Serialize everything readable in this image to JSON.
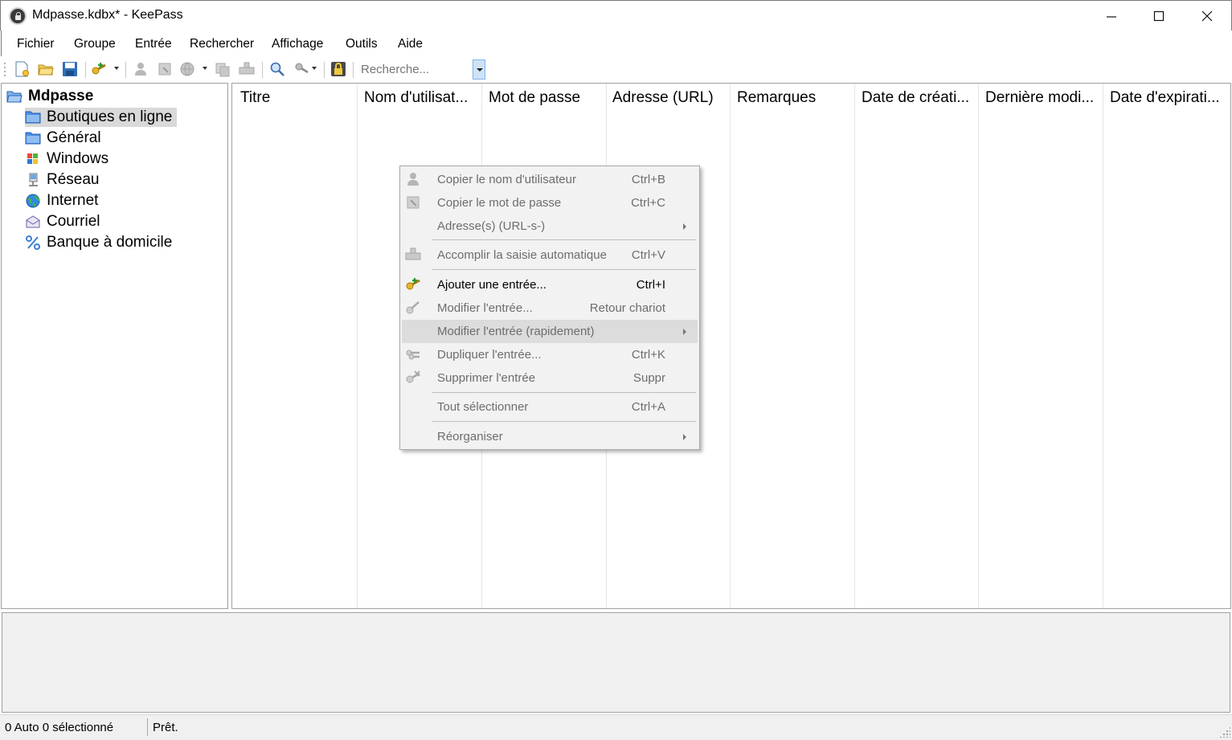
{
  "window": {
    "title": "Mdpasse.kdbx* - KeePass",
    "minimize_glyph": "—",
    "maximize_glyph": "☐",
    "close_glyph": "✕"
  },
  "menubar": {
    "items": [
      "Fichier",
      "Groupe",
      "Entrée",
      "Rechercher",
      "Affichage",
      "Outils",
      "Aide"
    ]
  },
  "toolbar": {
    "search_placeholder": "Recherche...",
    "icons": [
      "new-database-icon",
      "open-database-icon",
      "save-icon",
      "add-entry-icon",
      "copy-username-icon",
      "copy-password-icon",
      "open-url-icon",
      "copy-url-icon",
      "autotype-icon",
      "find-icon",
      "entry-list-icon",
      "lock-workspace-icon"
    ]
  },
  "tree": {
    "root": "Mdpasse",
    "groups": [
      {
        "label": "Boutiques en ligne",
        "icon": "folder-icon",
        "selected": true
      },
      {
        "label": "Général",
        "icon": "folder-icon",
        "selected": false
      },
      {
        "label": "Windows",
        "icon": "windows-icon",
        "selected": false
      },
      {
        "label": "Réseau",
        "icon": "network-icon",
        "selected": false
      },
      {
        "label": "Internet",
        "icon": "globe-icon",
        "selected": false
      },
      {
        "label": "Courriel",
        "icon": "envelope-icon",
        "selected": false
      },
      {
        "label": "Banque à domicile",
        "icon": "percent-icon",
        "selected": false
      }
    ]
  },
  "list": {
    "columns": [
      "Titre",
      "Nom d'utilisat...",
      "Mot de passe",
      "Adresse (URL)",
      "Remarques",
      "Date de créati...",
      "Dernière modi...",
      "Date d'expirati..."
    ]
  },
  "context_menu": {
    "items": [
      {
        "label": "Copier le nom d'utilisateur",
        "shortcut": "Ctrl+B",
        "icon": "user-icon",
        "enabled": false
      },
      {
        "label": "Copier le mot de passe",
        "shortcut": "Ctrl+C",
        "icon": "key-card-icon",
        "enabled": false
      },
      {
        "label": "Adresse(s) (URL-s-)",
        "shortcut": "",
        "icon": "",
        "enabled": false,
        "submenu": true
      },
      {
        "label": "Accomplir la saisie automatique",
        "shortcut": "Ctrl+V",
        "icon": "autotype-icon",
        "enabled": false
      },
      {
        "label": "Ajouter une entrée...",
        "shortcut": "Ctrl+I",
        "icon": "add-key-icon",
        "enabled": true
      },
      {
        "label": "Modifier l'entrée...",
        "shortcut": "Retour chariot",
        "icon": "edit-key-icon",
        "enabled": false
      },
      {
        "label": "Modifier l'entrée (rapidement)",
        "shortcut": "",
        "icon": "",
        "enabled": false,
        "submenu": true,
        "hover": true
      },
      {
        "label": "Dupliquer l'entrée...",
        "shortcut": "Ctrl+K",
        "icon": "duplicate-key-icon",
        "enabled": false
      },
      {
        "label": "Supprimer l'entrée",
        "shortcut": "Suppr",
        "icon": "delete-key-icon",
        "enabled": false
      },
      {
        "label": "Tout sélectionner",
        "shortcut": "Ctrl+A",
        "icon": "",
        "enabled": false
      },
      {
        "label": "Réorganiser",
        "shortcut": "",
        "icon": "",
        "enabled": false,
        "submenu": true
      }
    ]
  },
  "statusbar": {
    "left": "0 Auto 0 sélectionné",
    "right": "Prêt."
  }
}
